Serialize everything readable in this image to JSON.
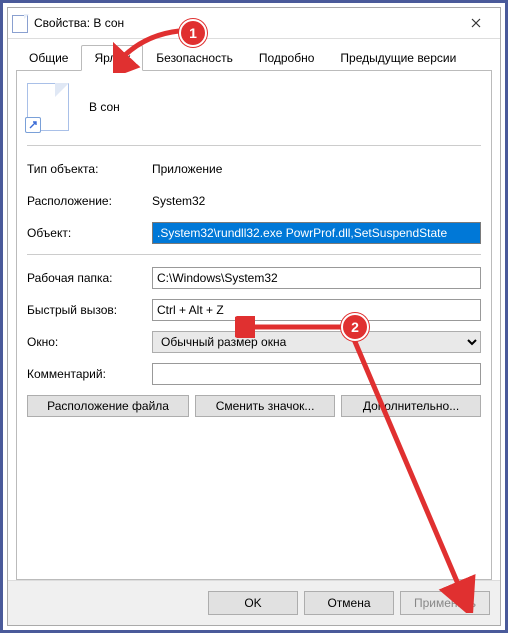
{
  "titlebar": {
    "title": "Свойства: В сон"
  },
  "tabs": [
    {
      "label": "Общие"
    },
    {
      "label": "Ярлык"
    },
    {
      "label": "Безопасность"
    },
    {
      "label": "Подробно"
    },
    {
      "label": "Предыдущие версии"
    }
  ],
  "shortcut": {
    "name": "В сон",
    "type_label": "Тип объекта:",
    "type_value": "Приложение",
    "location_label": "Расположение:",
    "location_value": "System32",
    "target_label": "Объект:",
    "target_value": ".System32\\rundll32.exe PowrProf.dll,SetSuspendState",
    "startin_label": "Рабочая папка:",
    "startin_value": "C:\\Windows\\System32",
    "hotkey_label": "Быстрый вызов:",
    "hotkey_value": "Ctrl + Alt + Z",
    "run_label": "Окно:",
    "run_value": "Обычный размер окна",
    "comment_label": "Комментарий:",
    "comment_value": ""
  },
  "buttons": {
    "open_location": "Расположение файла",
    "change_icon": "Сменить значок...",
    "advanced": "Дополнительно...",
    "ok": "OK",
    "cancel": "Отмена",
    "apply": "Применить"
  },
  "annotations": {
    "one": "1",
    "two": "2"
  }
}
